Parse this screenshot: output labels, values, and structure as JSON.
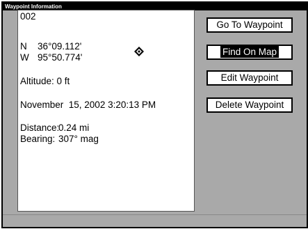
{
  "window": {
    "title": "Waypoint Information"
  },
  "waypoint": {
    "name": "002",
    "lat_hemisphere": "N",
    "lat_value": "36°09.112'",
    "lon_hemisphere": "W",
    "lon_value": "95°50.774'",
    "altitude": "Altitude: 0 ft",
    "datetime": "November  15, 2002 3:20:13 PM",
    "distance_label": "Distance:",
    "distance_value": "0.24 mi",
    "bearing_label": "Bearing:",
    "bearing_value": "307° mag",
    "icon": "waypoint-diamond-icon"
  },
  "actions": [
    {
      "label": "Go To Waypoint",
      "selected": false
    },
    {
      "label": "Find On Map",
      "selected": true
    },
    {
      "label": "Edit Waypoint",
      "selected": false
    },
    {
      "label": "Delete Waypoint",
      "selected": false
    }
  ],
  "colors": {
    "background": "#a9a9a9",
    "panel": "#ffffff",
    "selected": "#000000"
  }
}
